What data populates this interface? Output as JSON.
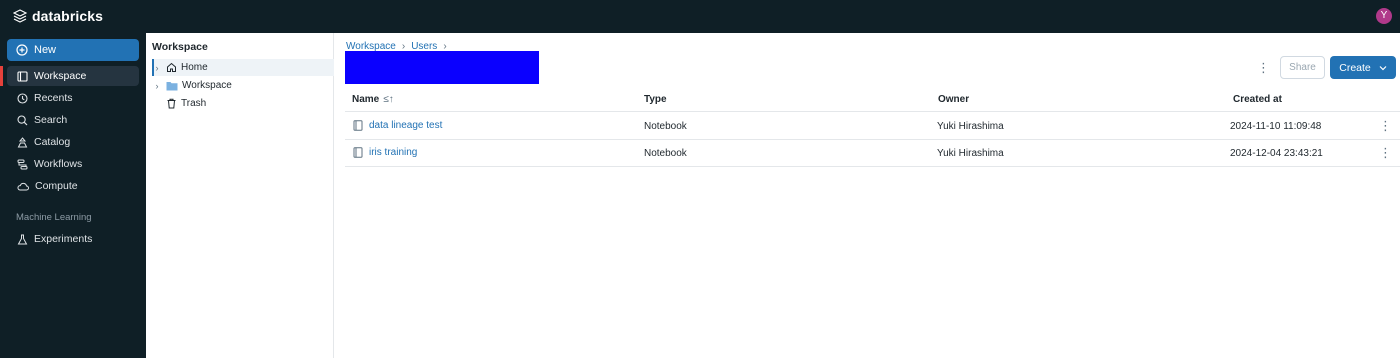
{
  "app": {
    "brand": "databricks",
    "avatar_initial": "Y",
    "avatar_color": "#b0398a",
    "accent_color": "#2272b4"
  },
  "sidebar": {
    "new_label": "New",
    "items": [
      {
        "label": "Workspace",
        "icon": "workspace-icon",
        "active": true
      },
      {
        "label": "Recents",
        "icon": "clock-icon"
      },
      {
        "label": "Search",
        "icon": "search-icon"
      },
      {
        "label": "Catalog",
        "icon": "catalog-icon"
      },
      {
        "label": "Workflows",
        "icon": "workflows-icon"
      },
      {
        "label": "Compute",
        "icon": "cloud-icon"
      }
    ],
    "section_label": "Machine Learning",
    "ml_items": [
      {
        "label": "Experiments",
        "icon": "flask-icon"
      }
    ]
  },
  "tree": {
    "title": "Workspace",
    "items": [
      {
        "label": "Home",
        "icon": "home-icon",
        "selected": true
      },
      {
        "label": "Workspace",
        "icon": "folder-icon"
      },
      {
        "label": "Trash",
        "icon": "trash-icon"
      }
    ]
  },
  "main": {
    "breadcrumbs": [
      "Workspace",
      "Users"
    ],
    "share_label": "Share",
    "create_label": "Create",
    "columns": [
      "Name",
      "Type",
      "Owner",
      "Created at"
    ],
    "rows": [
      {
        "name": "data lineage test",
        "type": "Notebook",
        "owner": "Yuki Hirashima",
        "created": "2024-11-10 11:09:48"
      },
      {
        "name": "iris training",
        "type": "Notebook",
        "owner": "Yuki Hirashima",
        "created": "2024-12-04 23:43:21"
      }
    ]
  }
}
